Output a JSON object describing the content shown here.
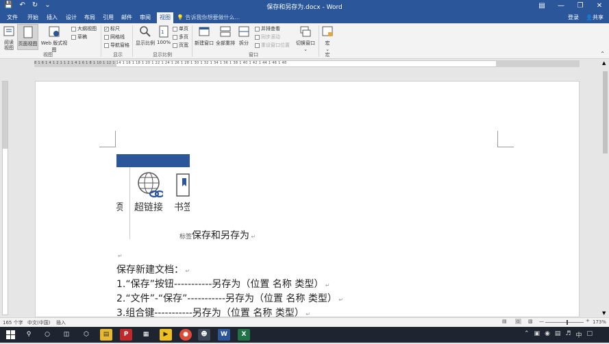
{
  "title_bar": {
    "title": "保存和另存为.docx - Word",
    "quick_access": [
      "save-icon",
      "undo-icon",
      "redo-icon",
      "customize-icon"
    ]
  },
  "tabs": {
    "items": [
      "文件",
      "开始",
      "插入",
      "设计",
      "布局",
      "引用",
      "邮件",
      "审阅",
      "视图"
    ],
    "active": "视图",
    "tell_me": "告诉我你想要做什么...",
    "signin": "登录",
    "share": "共享"
  },
  "ribbon": {
    "views": {
      "read": "阅读\n视图",
      "print": "页面视图",
      "web": "Web 版式视图",
      "outline": "大纲视图",
      "draft": "草稿",
      "group": "视图"
    },
    "show": {
      "ruler": "标尺",
      "gridlines": "网格线",
      "nav": "导航窗格",
      "group": "显示"
    },
    "zoom": {
      "zoom": "显示比例",
      "hundred": "100%",
      "one_page": "单页",
      "multi_page": "多页",
      "page_width": "页宽",
      "group": "显示比例"
    },
    "window": {
      "new": "新建窗口",
      "arrange": "全部重排",
      "split": "拆分",
      "side_by_side": "并排查看",
      "sync_scroll": "同步滚动",
      "reset_pos": "重设窗口位置",
      "switch": "切换窗口",
      "group": "窗口"
    },
    "macros": {
      "macros": "宏",
      "group": "宏"
    }
  },
  "ruler": {
    "numbers": "8 1 6 1 4 1 2 1 1 2 1 4 1 6 1 8 1 10 1 12 1 14 1 16 1 18 1 20 1 22 1 24 1 26 1 28 1 30 1 32 1 34 1 36 1 38 1 40 1 42 1 44 1 46 1 48"
  },
  "document": {
    "embedded": {
      "label_left": "项",
      "label_link": "超链接",
      "label_bookmark": "书签"
    },
    "heading_mark": "标签",
    "heading": "保存和另存为",
    "line1": "保存新建文档：",
    "line2": "1.“保存”按钮-----------另存为（位置 名称 类型）",
    "line3": "2.“文件”-“保存”-----------另存为（位置 名称 类型）",
    "line4": "3.组合键-----------另存为（位置 名称 类型）"
  },
  "status_bar": {
    "words": "165 个字",
    "language": "中文(中国)",
    "mode": "插入",
    "zoom": "173%"
  },
  "colors": {
    "brand": "#2b579a",
    "taskbar": "#1e2430"
  }
}
